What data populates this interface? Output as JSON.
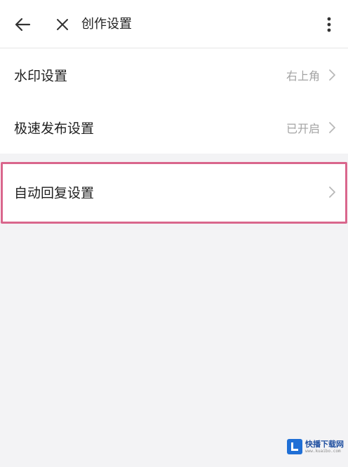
{
  "header": {
    "title": "创作设置",
    "back_icon": "arrow-left-icon",
    "close_icon": "close-icon",
    "more_icon": "more-vertical-icon"
  },
  "settings": [
    {
      "label": "水印设置",
      "value": "右上角",
      "icon": "chevron-right-icon"
    },
    {
      "label": "极速发布设置",
      "value": "已开启",
      "icon": "chevron-right-icon"
    },
    {
      "label": "自动回复设置",
      "value": "",
      "icon": "chevron-right-icon"
    }
  ],
  "highlight_color": "#d9668c",
  "watermark": {
    "name": "快播下载网",
    "url": "www.kuaibo.com"
  }
}
